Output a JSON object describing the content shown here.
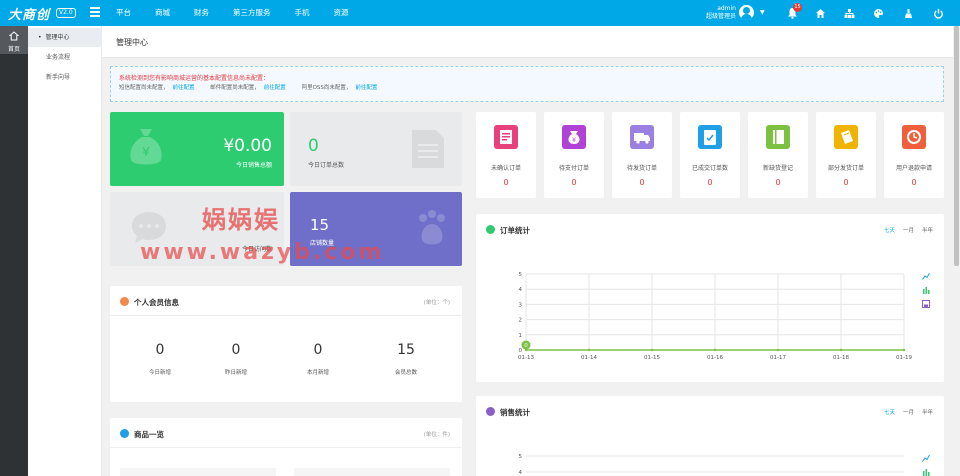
{
  "brand": {
    "logo": "大商创",
    "version": "V2.0"
  },
  "topnav": [
    "平台",
    "商城",
    "财务",
    "第三方服务",
    "手机",
    "资源"
  ],
  "user": {
    "name": "admin",
    "role": "超级管理员",
    "notifications": "15"
  },
  "sidebar": {
    "home": "首页",
    "items": [
      "管理中心",
      "业务流程",
      "新手向导"
    ]
  },
  "page": {
    "title": "管理中心"
  },
  "notice": {
    "title": "系统检测到您有影响商城运营的基本配置信息尚未配置：",
    "items": [
      {
        "text": "短信配置尚未配置，",
        "link": "前往配置"
      },
      {
        "text": "邮件配置尚未配置，",
        "link": "前往配置"
      },
      {
        "text": "阿里OSS尚未配置，",
        "link": "前往配置"
      }
    ]
  },
  "stats": {
    "sales": {
      "value": "¥0.00",
      "label": "今日销售总额"
    },
    "orders": {
      "value": "0",
      "label": "今日订单总数"
    },
    "visits": {
      "label": "今日访问数"
    },
    "shops": {
      "value": "15",
      "label": "店铺数量"
    }
  },
  "members": {
    "title": "个人会员信息",
    "unit": "(单位：个)",
    "items": [
      {
        "value": "0",
        "label": "今日新增"
      },
      {
        "value": "0",
        "label": "昨日新增"
      },
      {
        "value": "0",
        "label": "本月新增"
      },
      {
        "value": "15",
        "label": "会员总数"
      }
    ]
  },
  "goods": {
    "title": "商品一览",
    "unit": "(单位：件)"
  },
  "order_tiles": [
    {
      "label": "未确认订单",
      "value": "0",
      "color": "#e8407a",
      "icon": "document-icon"
    },
    {
      "label": "待支付订单",
      "value": "0",
      "color": "#b042d6",
      "icon": "yen-bag-icon"
    },
    {
      "label": "待发货订单",
      "value": "0",
      "color": "#9a80e0",
      "icon": "truck-icon"
    },
    {
      "label": "已成交订单数",
      "value": "0",
      "color": "#1e9fe6",
      "icon": "clipboard-check-icon"
    },
    {
      "label": "新缺货登记",
      "value": "0",
      "color": "#7cc142",
      "icon": "notebook-icon"
    },
    {
      "label": "部分发货订单",
      "value": "0",
      "color": "#f0b400",
      "icon": "package-icon"
    },
    {
      "label": "用户退款申请",
      "value": "0",
      "color": "#ef5f3b",
      "icon": "refund-icon"
    }
  ],
  "order_chart": {
    "title": "订单统计",
    "ranges": [
      "七天",
      "一月",
      "半年"
    ],
    "selected": "七天"
  },
  "sales_chart": {
    "title": "销售统计",
    "ranges": [
      "七天",
      "一月",
      "半年"
    ],
    "selected": "七天"
  },
  "watermark": {
    "cn": "娲娲娱",
    "url": "www.wazyb.com"
  },
  "colors": {
    "topbar": "#00a8e8",
    "green": "#2ecc71",
    "purple": "#6f6fc9",
    "gray_tile": "#e8eaeb"
  },
  "chart_data": [
    {
      "type": "line",
      "title": "订单统计",
      "x": [
        "01-13",
        "01-14",
        "01-15",
        "01-16",
        "01-17",
        "01-18",
        "01-19"
      ],
      "series": [
        {
          "values": [
            0,
            0,
            0,
            0,
            0,
            0,
            0
          ]
        }
      ],
      "data_labels": [
        {
          "x": "01-13",
          "text": "0"
        }
      ],
      "ylim": [
        0,
        5
      ],
      "yticks": [
        0,
        1,
        2,
        3,
        4,
        5
      ],
      "grid": true
    },
    {
      "type": "line",
      "title": "销售统计",
      "x": [],
      "series": [],
      "yticks": [
        4,
        5
      ],
      "grid": true
    }
  ]
}
